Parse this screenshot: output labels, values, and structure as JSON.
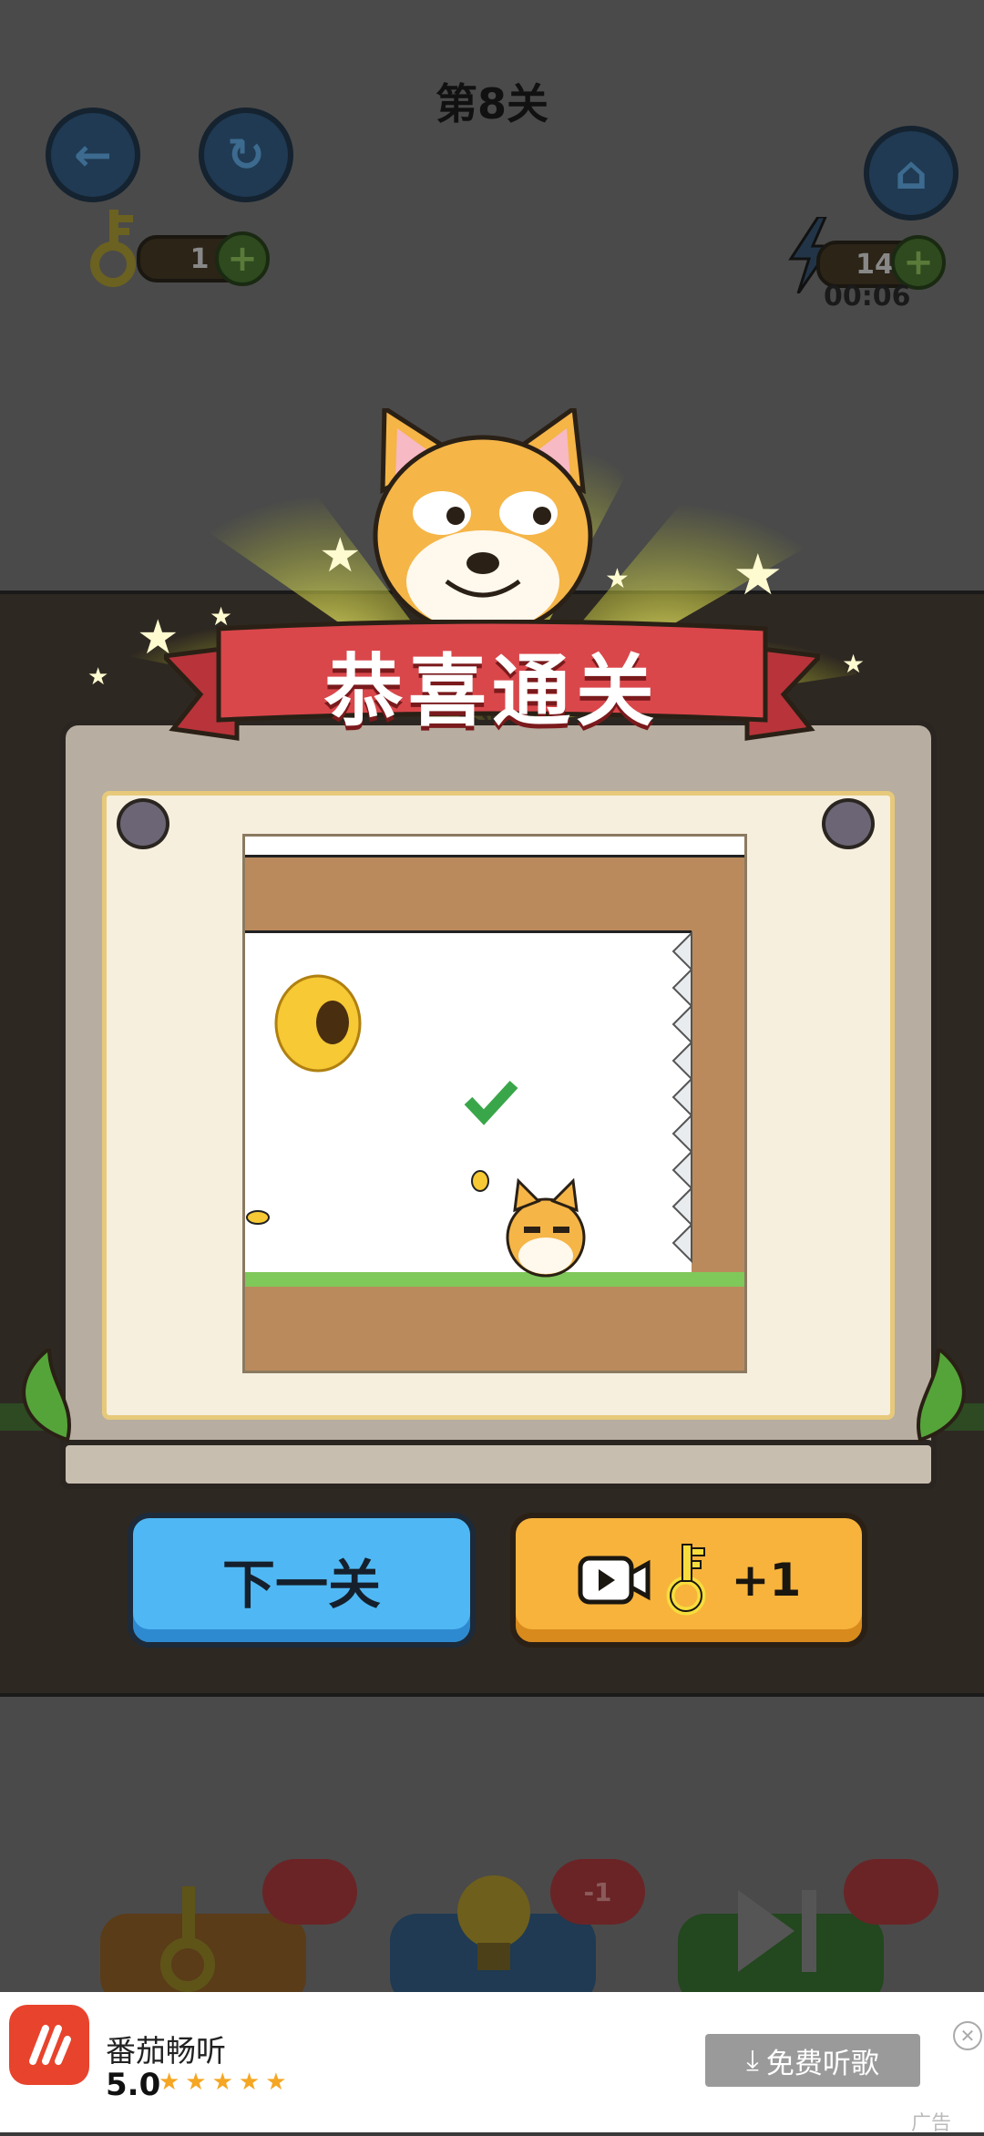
{
  "header": {
    "level_title": "第8关",
    "back_icon": "arrow-left-icon",
    "restart_icon": "restart-icon",
    "home_icon": "home-icon",
    "keys_count": "1",
    "energy_count": "14",
    "timer": "00:06"
  },
  "dialog": {
    "banner_text": "恭喜通关",
    "next_button_label": "下一关",
    "reward_suffix": "+1",
    "colors": {
      "banner_red": "#d9474b",
      "next_blue": "#4fb8f4",
      "reward_orange": "#f7b33c",
      "check_green": "#3aa64a"
    }
  },
  "bottom_tools": {
    "hint_cost": "-1"
  },
  "ad": {
    "app_name": "番茄畅听",
    "rating": "5.0",
    "stars": "★★★★★",
    "cta_label": "免费听歌",
    "close_symbol": "✕",
    "ad_label": "广告"
  }
}
